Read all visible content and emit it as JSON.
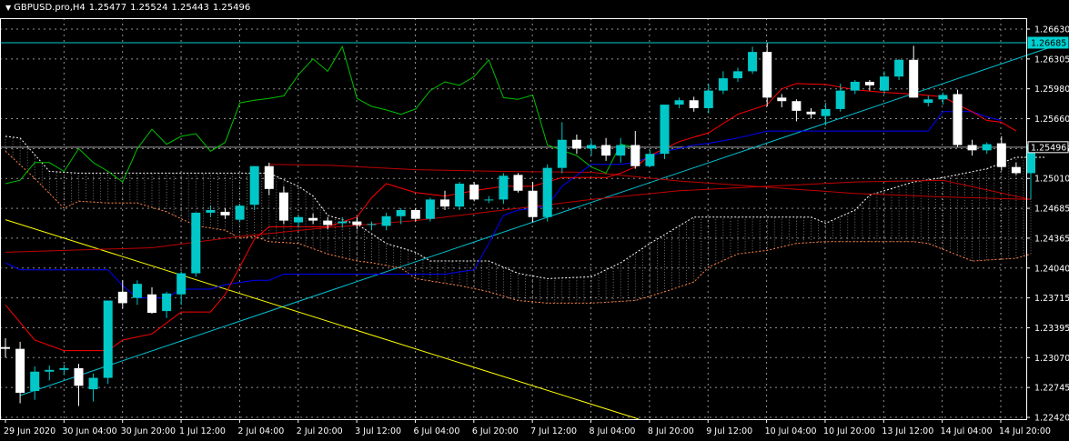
{
  "header": {
    "symbol": "GBPUSD.pro,H4",
    "ohlc": [
      "1.25477",
      "1.25524",
      "1.25443",
      "1.25496"
    ]
  },
  "colors": {
    "background": "#000000",
    "grid": "#c0c0c0",
    "bull_candle": "#00c8c8",
    "bear_candle": "#ffffff",
    "tenkan": "#ff0000",
    "kijun": "#0000ff",
    "chikou": "#00c000",
    "senkou_a": "#ff8040",
    "senkou_b": "#ffffff",
    "ma": "#c00000",
    "resistance_line": "#00d0d0",
    "support_trend": "#00c0d0",
    "down_trend": "#ffff00",
    "tag_line": "#00c8c8"
  },
  "chart_data": {
    "type": "candlestick",
    "y_range": [
      1.2242,
      1.2684
    ],
    "y_ticks": [
      "1.26630",
      "1.26305",
      "1.25980",
      "1.25660",
      "1.25335",
      "1.25010",
      "1.24685",
      "1.24365",
      "1.24040",
      "1.23715",
      "1.23395",
      "1.23070",
      "1.22745",
      "1.22420"
    ],
    "x_labels": [
      "29 Jun 2020",
      "30 Jun 04:00",
      "30 Jun 20:00",
      "1 Jul 12:00",
      "2 Jul 04:00",
      "2 Jul 20:00",
      "3 Jul 12:00",
      "6 Jul 04:00",
      "6 Jul 20:00",
      "7 Jul 12:00",
      "8 Jul 04:00",
      "8 Jul 20:00",
      "9 Jul 12:00",
      "10 Jul 04:00",
      "10 Jul 20:00",
      "13 Jul 12:00",
      "14 Jul 04:00",
      "14 Jul 20:00"
    ],
    "price_tags": [
      "1.26685",
      "1.25496"
    ],
    "candles": [
      [
        1.2322,
        1.2332,
        1.231,
        1.232
      ],
      [
        1.232,
        1.2328,
        1.2258,
        1.227
      ],
      [
        1.2272,
        1.23,
        1.2262,
        1.2294
      ],
      [
        1.2294,
        1.2301,
        1.2284,
        1.2296
      ],
      [
        1.2296,
        1.2302,
        1.229,
        1.2298
      ],
      [
        1.2298,
        1.2303,
        1.2255,
        1.2278
      ],
      [
        1.2274,
        1.2292,
        1.226,
        1.2287
      ],
      [
        1.2287,
        1.2375,
        1.228,
        1.2375
      ],
      [
        1.2385,
        1.2398,
        1.2366,
        1.2372
      ],
      [
        1.2378,
        1.2398,
        1.237,
        1.2394
      ],
      [
        1.2382,
        1.239,
        1.236,
        1.2361
      ],
      [
        1.2363,
        1.2385,
        1.2355,
        1.2383
      ],
      [
        1.2382,
        1.2408,
        1.237,
        1.2406
      ],
      [
        1.2406,
        1.2475,
        1.2402,
        1.2475
      ],
      [
        1.2475,
        1.2483,
        1.247,
        1.2478
      ],
      [
        1.2476,
        1.248,
        1.2468,
        1.2472
      ],
      [
        1.2467,
        1.2484,
        1.2464,
        1.2483
      ],
      [
        1.2484,
        1.2528,
        1.2478,
        1.2528
      ],
      [
        1.2528,
        1.2532,
        1.2495,
        1.2502
      ],
      [
        1.2498,
        1.2505,
        1.2462,
        1.2466
      ],
      [
        1.2464,
        1.2472,
        1.2458,
        1.247
      ],
      [
        1.2469,
        1.2474,
        1.2462,
        1.2466
      ],
      [
        1.2466,
        1.247,
        1.2456,
        1.2461
      ],
      [
        1.2463,
        1.247,
        1.2458,
        1.2465
      ],
      [
        1.2465,
        1.247,
        1.2456,
        1.2461
      ],
      [
        1.2461,
        1.2465,
        1.2455,
        1.2462
      ],
      [
        1.246,
        1.2475,
        1.2455,
        1.2471
      ],
      [
        1.2471,
        1.248,
        1.2462,
        1.2478
      ],
      [
        1.2478,
        1.248,
        1.2465,
        1.2468
      ],
      [
        1.2468,
        1.2492,
        1.2465,
        1.249
      ],
      [
        1.249,
        1.25,
        1.2478,
        1.2482
      ],
      [
        1.2482,
        1.251,
        1.2478,
        1.2508
      ],
      [
        1.2507,
        1.251,
        1.2488,
        1.249
      ],
      [
        1.249,
        1.2494,
        1.2486,
        1.249
      ],
      [
        1.249,
        1.252,
        1.2485,
        1.2517
      ],
      [
        1.2518,
        1.252,
        1.2498,
        1.25
      ],
      [
        1.25,
        1.251,
        1.2464,
        1.247
      ],
      [
        1.247,
        1.253,
        1.2465,
        1.2526
      ],
      [
        1.2526,
        1.2578,
        1.252,
        1.2558
      ],
      [
        1.2558,
        1.2564,
        1.2542,
        1.2548
      ],
      [
        1.2548,
        1.2558,
        1.254,
        1.2552
      ],
      [
        1.2552,
        1.256,
        1.2534,
        1.254
      ],
      [
        1.254,
        1.256,
        1.2532,
        1.2552
      ],
      [
        1.2552,
        1.2568,
        1.2525,
        1.2528
      ],
      [
        1.2528,
        1.2546,
        1.2527,
        1.2542
      ],
      [
        1.2542,
        1.2598,
        1.2536,
        1.2598
      ],
      [
        1.2598,
        1.2606,
        1.2594,
        1.2603
      ],
      [
        1.2603,
        1.2607,
        1.259,
        1.2594
      ],
      [
        1.2594,
        1.2622,
        1.2588,
        1.2614
      ],
      [
        1.2614,
        1.2636,
        1.261,
        1.2628
      ],
      [
        1.2628,
        1.264,
        1.2624,
        1.2636
      ],
      [
        1.2636,
        1.2664,
        1.2633,
        1.2658
      ],
      [
        1.2658,
        1.2668,
        1.2596,
        1.2606
      ],
      [
        1.2606,
        1.261,
        1.2595,
        1.2602
      ],
      [
        1.2602,
        1.2604,
        1.2579,
        1.2591
      ],
      [
        1.259,
        1.2594,
        1.2582,
        1.2587
      ],
      [
        1.2585,
        1.26,
        1.2574,
        1.2593
      ],
      [
        1.2593,
        1.2622,
        1.259,
        1.2614
      ],
      [
        1.2614,
        1.2626,
        1.261,
        1.2624
      ],
      [
        1.2624,
        1.2626,
        1.2614,
        1.262
      ],
      [
        1.2614,
        1.2636,
        1.261,
        1.263
      ],
      [
        1.263,
        1.265,
        1.2626,
        1.2649
      ],
      [
        1.2649,
        1.2665,
        1.2606,
        1.2606
      ],
      [
        1.26,
        1.2608,
        1.2596,
        1.2604
      ],
      [
        1.2604,
        1.2612,
        1.2598,
        1.2609
      ],
      [
        1.261,
        1.2615,
        1.255,
        1.2552
      ],
      [
        1.2552,
        1.2558,
        1.254,
        1.2546
      ],
      [
        1.2546,
        1.2555,
        1.2542,
        1.2553
      ],
      [
        1.2554,
        1.2562,
        1.2523,
        1.2527
      ],
      [
        1.2527,
        1.2532,
        1.2518,
        1.252
      ],
      [
        1.252,
        1.2553,
        1.249,
        1.2553
      ],
      [
        1.25477,
        1.25524,
        1.25443,
        1.25496
      ]
    ],
    "indicators": {
      "tenkan": [
        [
          0,
          1.237
        ],
        [
          2,
          1.233
        ],
        [
          4,
          1.2318
        ],
        [
          5,
          1.2318
        ],
        [
          7,
          1.2318
        ],
        [
          8,
          1.233
        ],
        [
          10,
          1.2337
        ],
        [
          12,
          1.2362
        ],
        [
          14,
          1.2362
        ],
        [
          15,
          1.2382
        ],
        [
          17,
          1.2445
        ],
        [
          18,
          1.2459
        ],
        [
          22,
          1.2459
        ],
        [
          24,
          1.247
        ],
        [
          25,
          1.2492
        ],
        [
          26,
          1.2508
        ],
        [
          28,
          1.2498
        ],
        [
          30,
          1.2494
        ],
        [
          32,
          1.25
        ],
        [
          34,
          1.2505
        ],
        [
          36,
          1.2505
        ],
        [
          38,
          1.2515
        ],
        [
          40,
          1.2515
        ],
        [
          41,
          1.2515
        ],
        [
          42,
          1.252
        ],
        [
          43,
          1.2527
        ],
        [
          44,
          1.254
        ],
        [
          46,
          1.2556
        ],
        [
          48,
          1.2566
        ],
        [
          50,
          1.2587
        ],
        [
          52,
          1.2598
        ],
        [
          53,
          1.2616
        ],
        [
          54,
          1.2622
        ],
        [
          56,
          1.2621
        ],
        [
          58,
          1.2615
        ],
        [
          60,
          1.2612
        ],
        [
          62,
          1.261
        ],
        [
          64,
          1.2607
        ],
        [
          65,
          1.2598
        ],
        [
          66,
          1.259
        ],
        [
          67,
          1.258
        ],
        [
          68,
          1.2578
        ],
        [
          69,
          1.2568
        ]
      ],
      "kijun": [
        [
          0,
          1.2418
        ],
        [
          1,
          1.241
        ],
        [
          7,
          1.241
        ],
        [
          8,
          1.2392
        ],
        [
          9,
          1.2378
        ],
        [
          11,
          1.2378
        ],
        [
          12,
          1.2388
        ],
        [
          14,
          1.2388
        ],
        [
          15,
          1.2393
        ],
        [
          17,
          1.2398
        ],
        [
          18,
          1.2398
        ],
        [
          19,
          1.2405
        ],
        [
          30,
          1.2405
        ],
        [
          32,
          1.241
        ],
        [
          33,
          1.244
        ],
        [
          34,
          1.2472
        ],
        [
          35,
          1.2478
        ],
        [
          36,
          1.248
        ],
        [
          37,
          1.2483
        ],
        [
          38,
          1.2505
        ],
        [
          40,
          1.253
        ],
        [
          42,
          1.253
        ],
        [
          43,
          1.2532
        ],
        [
          44,
          1.2539
        ],
        [
          45,
          1.2545
        ],
        [
          46,
          1.2548
        ],
        [
          47,
          1.2552
        ],
        [
          48,
          1.2554
        ],
        [
          50,
          1.256
        ],
        [
          52,
          1.2568
        ],
        [
          60,
          1.2568
        ],
        [
          63,
          1.2568
        ],
        [
          64,
          1.259
        ],
        [
          66,
          1.259
        ],
        [
          67,
          1.2584
        ],
        [
          68,
          1.258
        ]
      ],
      "chikou": [
        [
          0,
          1.2508
        ],
        [
          1,
          1.2512
        ],
        [
          2,
          1.2532
        ],
        [
          3,
          1.2532
        ],
        [
          4,
          1.2522
        ],
        [
          5,
          1.2548
        ],
        [
          6,
          1.2532
        ],
        [
          7,
          1.2522
        ],
        [
          8,
          1.251
        ],
        [
          9,
          1.2548
        ],
        [
          10,
          1.257
        ],
        [
          11,
          1.2553
        ],
        [
          12,
          1.2562
        ],
        [
          13,
          1.2565
        ],
        [
          14,
          1.2545
        ],
        [
          15,
          1.2555
        ],
        [
          16,
          1.26
        ],
        [
          17,
          1.2603
        ],
        [
          18,
          1.2605
        ],
        [
          19,
          1.2608
        ],
        [
          20,
          1.2632
        ],
        [
          21,
          1.265
        ],
        [
          22,
          1.2636
        ],
        [
          23,
          1.2664
        ],
        [
          24,
          1.2605
        ],
        [
          25,
          1.2596
        ],
        [
          26,
          1.2592
        ],
        [
          27,
          1.2587
        ],
        [
          28,
          1.2593
        ],
        [
          29,
          1.2614
        ],
        [
          30,
          1.2624
        ],
        [
          31,
          1.262
        ],
        [
          32,
          1.263
        ],
        [
          33,
          1.2649
        ],
        [
          34,
          1.2606
        ],
        [
          35,
          1.2604
        ],
        [
          36,
          1.2609
        ],
        [
          37,
          1.2552
        ],
        [
          38,
          1.2546
        ],
        [
          39,
          1.254
        ],
        [
          40,
          1.2527
        ],
        [
          41,
          1.252
        ],
        [
          42,
          1.2553
        ],
        [
          43,
          1.2549
        ]
      ],
      "senkou_a": [
        [
          0,
          1.2545
        ],
        [
          2,
          1.2514
        ],
        [
          4,
          1.248
        ],
        [
          5,
          1.2488
        ],
        [
          7,
          1.2486
        ],
        [
          9,
          1.2486
        ],
        [
          11,
          1.2476
        ],
        [
          13,
          1.246
        ],
        [
          15,
          1.2455
        ],
        [
          16,
          1.2446
        ],
        [
          17,
          1.2448
        ],
        [
          18,
          1.2442
        ],
        [
          20,
          1.244
        ],
        [
          22,
          1.2428
        ],
        [
          24,
          1.242
        ],
        [
          25,
          1.2418
        ],
        [
          27,
          1.2412
        ],
        [
          28,
          1.24
        ],
        [
          31,
          1.2392
        ],
        [
          33,
          1.2385
        ],
        [
          35,
          1.2375
        ],
        [
          37,
          1.2372
        ],
        [
          40,
          1.2372
        ],
        [
          43,
          1.2375
        ],
        [
          45,
          1.2385
        ],
        [
          47,
          1.2396
        ],
        [
          48,
          1.2413
        ],
        [
          50,
          1.2428
        ],
        [
          52,
          1.2432
        ],
        [
          54,
          1.244
        ],
        [
          56,
          1.2442
        ],
        [
          62,
          1.2442
        ],
        [
          63,
          1.244
        ],
        [
          66,
          1.242
        ],
        [
          69,
          1.2423
        ],
        [
          70,
          1.2428
        ]
      ],
      "senkou_b": [
        [
          0,
          1.2562
        ],
        [
          1,
          1.256
        ],
        [
          3,
          1.2522
        ],
        [
          5,
          1.252
        ],
        [
          10,
          1.252
        ],
        [
          16,
          1.252
        ],
        [
          18,
          1.252
        ],
        [
          20,
          1.2505
        ],
        [
          21,
          1.2494
        ],
        [
          22,
          1.2472
        ],
        [
          24,
          1.2462
        ],
        [
          26,
          1.244
        ],
        [
          28,
          1.243
        ],
        [
          29,
          1.242
        ],
        [
          30,
          1.242
        ],
        [
          33,
          1.242
        ],
        [
          35,
          1.2406
        ],
        [
          37,
          1.24
        ],
        [
          40,
          1.2402
        ],
        [
          42,
          1.2418
        ],
        [
          44,
          1.244
        ],
        [
          46,
          1.246
        ],
        [
          47,
          1.247
        ],
        [
          55,
          1.247
        ],
        [
          56,
          1.2463
        ],
        [
          58,
          1.2478
        ],
        [
          59,
          1.2495
        ],
        [
          62,
          1.251
        ],
        [
          64,
          1.2515
        ],
        [
          67,
          1.2525
        ],
        [
          69,
          1.2538
        ],
        [
          71,
          1.2538
        ]
      ],
      "ma_slow": [
        [
          0,
          1.243
        ],
        [
          10,
          1.2435
        ],
        [
          16,
          1.2448
        ],
        [
          22,
          1.2458
        ],
        [
          28,
          1.2466
        ],
        [
          34,
          1.2478
        ],
        [
          40,
          1.249
        ],
        [
          46,
          1.25
        ],
        [
          52,
          1.2505
        ],
        [
          58,
          1.251
        ],
        [
          64,
          1.2512
        ],
        [
          70,
          1.249
        ]
      ],
      "ma_flat": [
        [
          18,
          1.253
        ],
        [
          22,
          1.2529
        ],
        [
          28,
          1.2524
        ],
        [
          34,
          1.2522
        ],
        [
          40,
          1.2521
        ],
        [
          46,
          1.2511
        ],
        [
          52,
          1.2504
        ],
        [
          58,
          1.2497
        ],
        [
          64,
          1.2493
        ],
        [
          70,
          1.249
        ]
      ]
    },
    "lines": {
      "resistance": 1.26685,
      "bid": 1.25496,
      "support_trend": [
        [
          1,
          1.2267
        ],
        [
          72,
          1.2667
        ]
      ],
      "down_trend": [
        [
          0,
          1.2467
        ],
        [
          42,
          1.2242
        ]
      ]
    }
  }
}
